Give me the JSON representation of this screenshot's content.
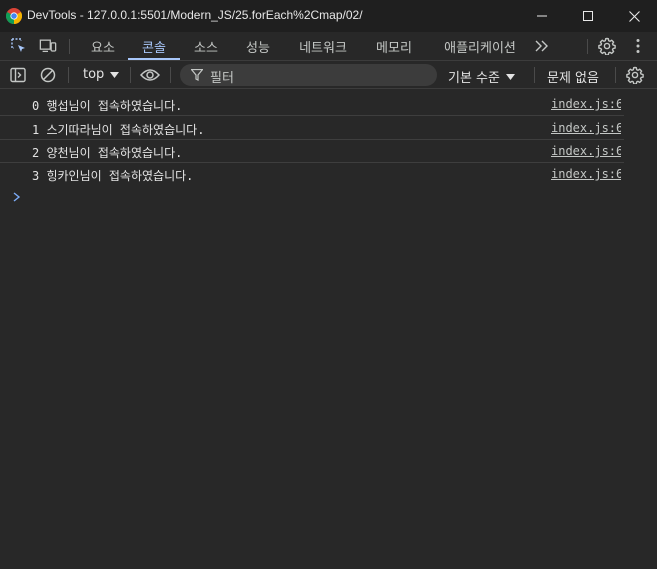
{
  "window": {
    "app_icon": "chrome-icon",
    "title": "DevTools - 127.0.0.1:5501/Modern_JS/25.forEach%2Cmap/02/"
  },
  "tabbar": {
    "tabs": [
      {
        "label": "요소",
        "active": false
      },
      {
        "label": "콘솔",
        "active": true
      },
      {
        "label": "소스",
        "active": false
      },
      {
        "label": "성능",
        "active": false
      },
      {
        "label": "네트워크",
        "active": false
      },
      {
        "label": "메모리",
        "active": false
      },
      {
        "label": "애플리케이션",
        "active": false
      }
    ],
    "more_label": ">>"
  },
  "console_toolbar": {
    "context": "top",
    "filter_placeholder": "필터",
    "levels_label": "기본 수준",
    "issues_label": "문제 없음"
  },
  "messages": [
    {
      "text": "0 행섭님이 접속하였습니다.",
      "source": "index.js:6"
    },
    {
      "text": "1 스기따라님이 접속하였습니다.",
      "source": "index.js:6"
    },
    {
      "text": "2 양천님이 접속하였습니다.",
      "source": "index.js:6"
    },
    {
      "text": "3 힝카인님이 접속하였습니다.",
      "source": "index.js:6"
    }
  ],
  "colors": {
    "background": "#282828",
    "titlebar": "#1f1f1f",
    "accent": "#a8c7fa",
    "text": "#e3e3e3"
  }
}
